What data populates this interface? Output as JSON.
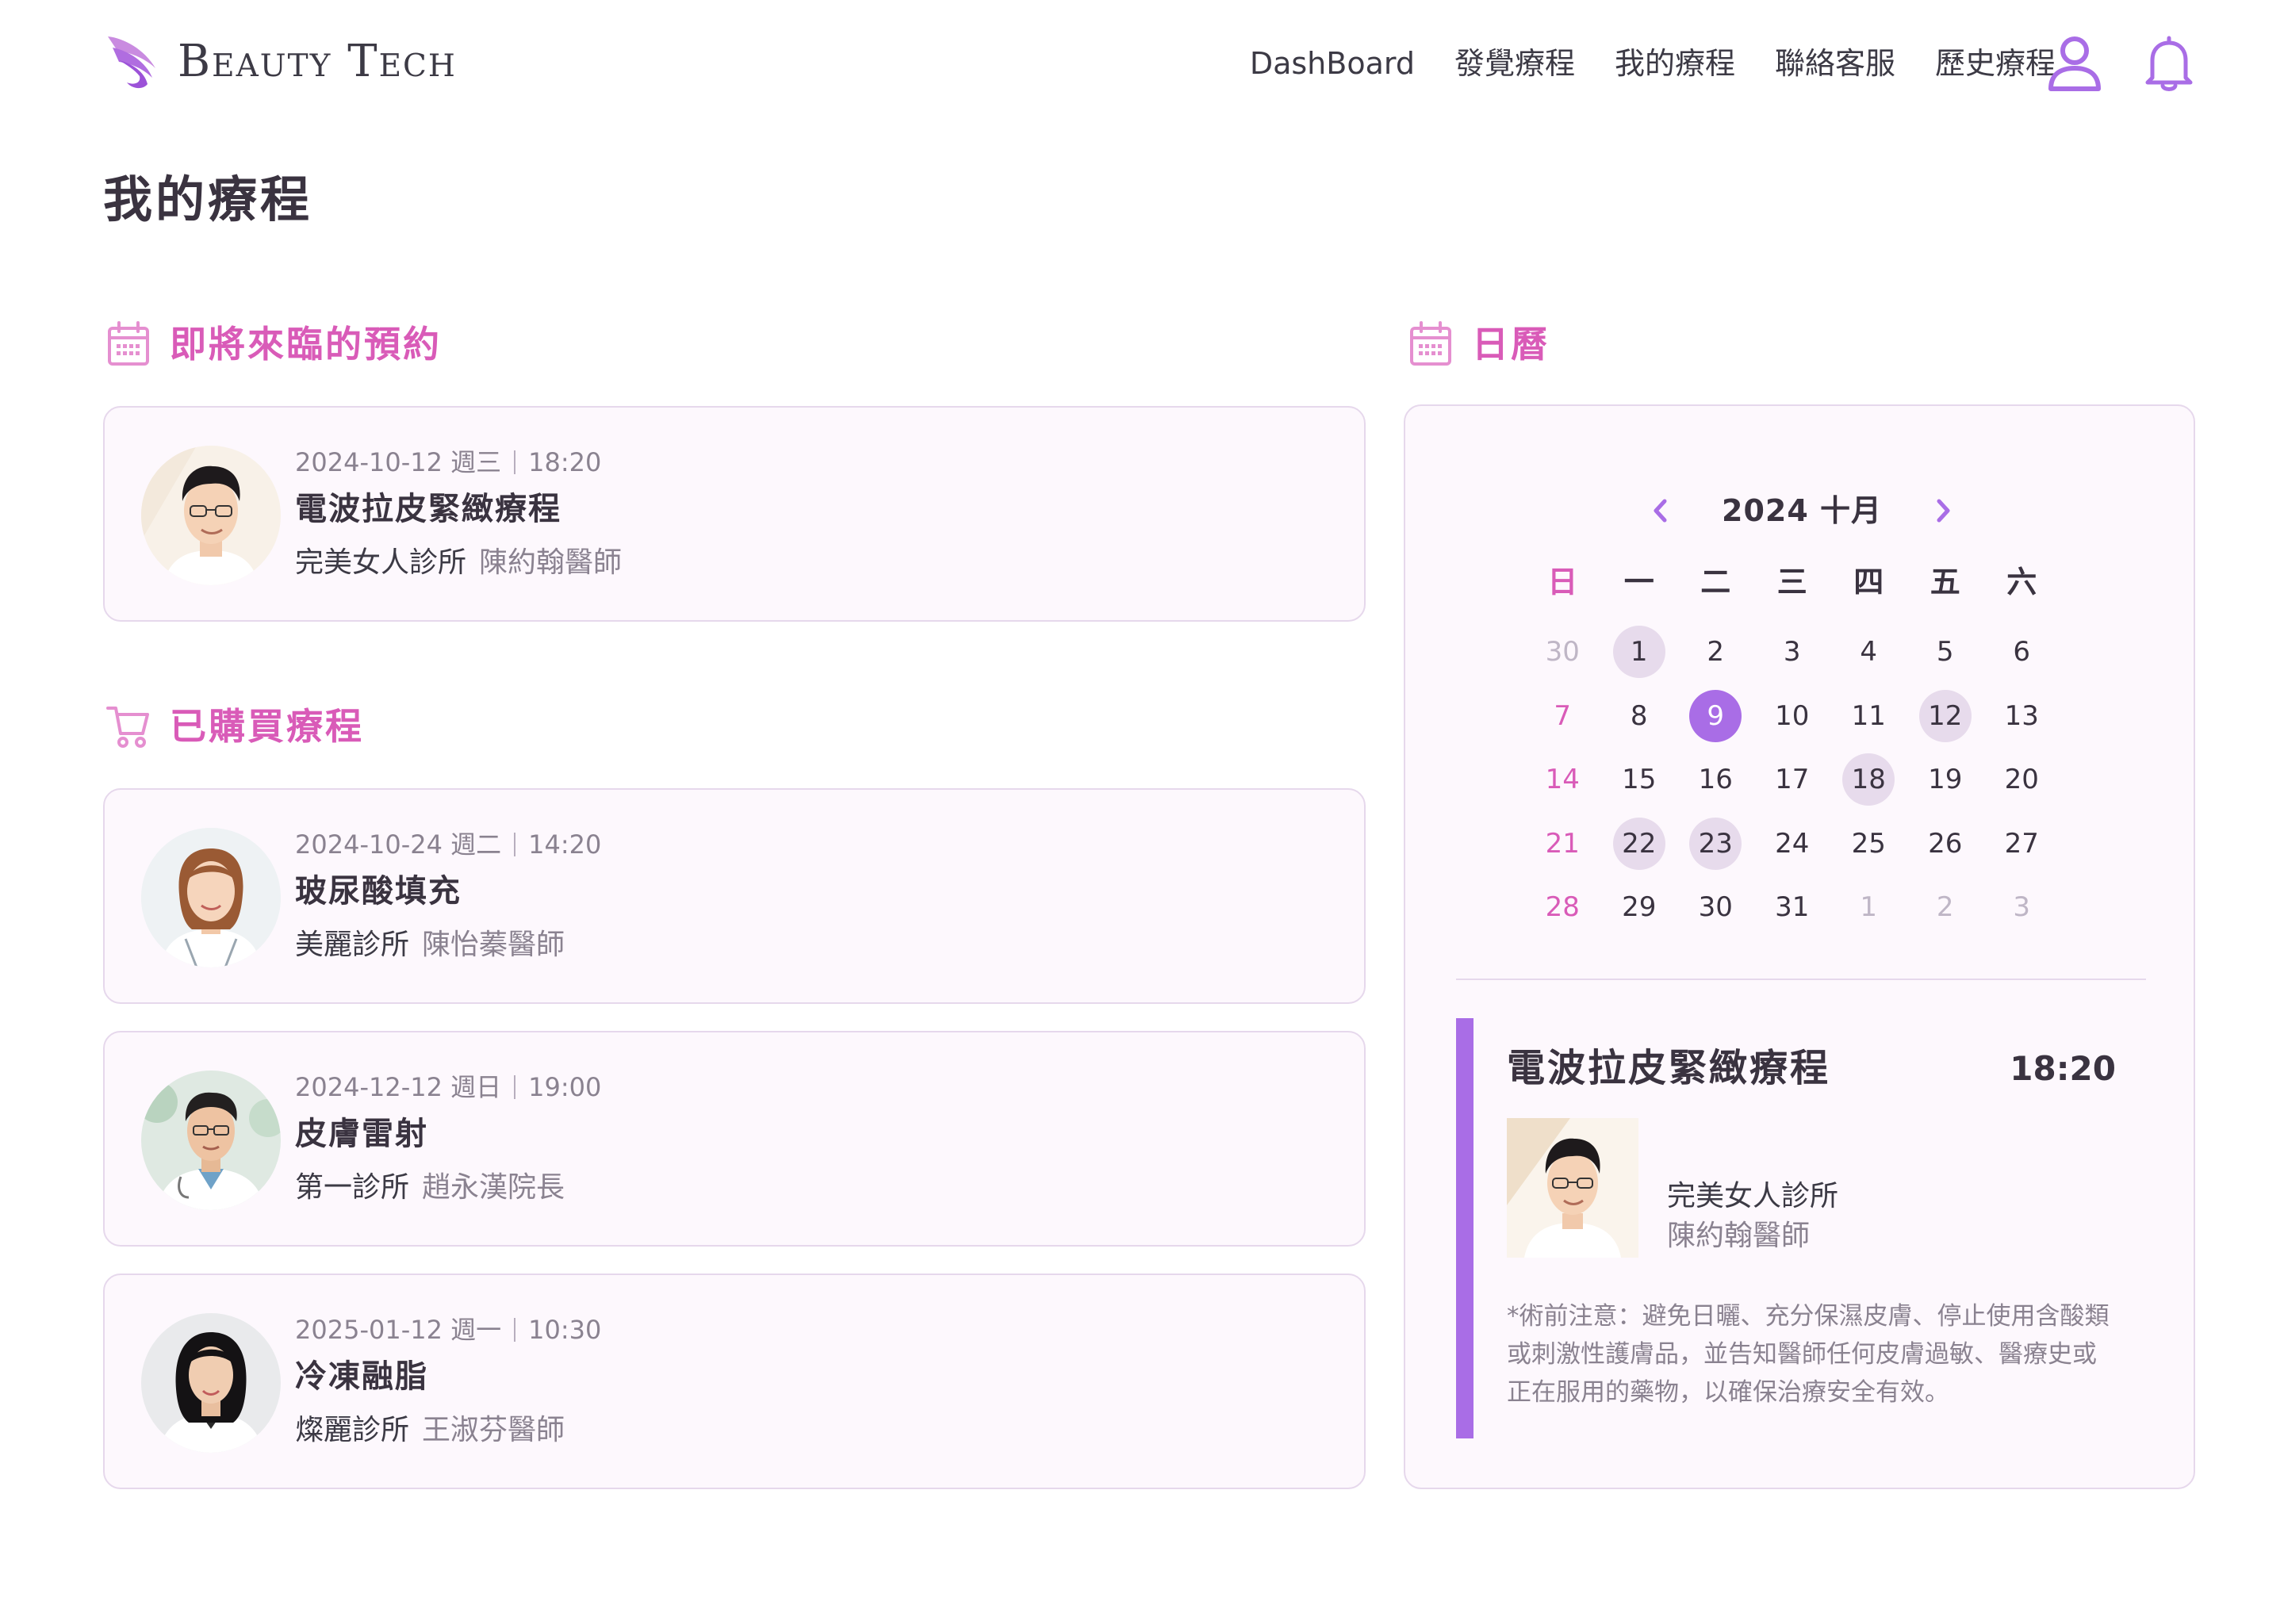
{
  "brand": {
    "name": "Beauty Tech",
    "accent": "#d95bb8",
    "primary": "#a96de6"
  },
  "nav": {
    "items": [
      "DashBoard",
      "發覺療程",
      "我的療程",
      "聯絡客服",
      "歷史療程"
    ]
  },
  "icons": {
    "user": "user-icon",
    "bell": "bell-icon",
    "calendar": "calendar-icon",
    "cart": "cart-icon"
  },
  "page": {
    "title": "我的療程"
  },
  "upcoming": {
    "heading": "即將來臨的預約",
    "items": [
      {
        "date": "2024-10-12 週三",
        "time": "18:20",
        "treatment": "電波拉皮緊緻療程",
        "clinic": "完美女人診所",
        "doctor": "陳約翰醫師"
      }
    ]
  },
  "purchased": {
    "heading": "已購買療程",
    "items": [
      {
        "date": "2024-10-24 週二",
        "time": "14:20",
        "treatment": "玻尿酸填充",
        "clinic": "美麗診所",
        "doctor": "陳怡蓁醫師"
      },
      {
        "date": "2024-12-12 週日",
        "time": "19:00",
        "treatment": "皮膚雷射",
        "clinic": "第一診所",
        "doctor": "趙永漢院長"
      },
      {
        "date": "2025-01-12 週一",
        "time": "10:30",
        "treatment": "冷凍融脂",
        "clinic": "燦麗診所",
        "doctor": "王淑芬醫師"
      }
    ]
  },
  "calendar": {
    "heading": "日曆",
    "month_label": "2024 十月",
    "weekdays": [
      "日",
      "一",
      "二",
      "三",
      "四",
      "五",
      "六"
    ],
    "days": [
      {
        "d": "30",
        "other": true
      },
      {
        "d": "1",
        "booked": true
      },
      {
        "d": "2"
      },
      {
        "d": "3"
      },
      {
        "d": "4"
      },
      {
        "d": "5"
      },
      {
        "d": "6"
      },
      {
        "d": "7"
      },
      {
        "d": "8"
      },
      {
        "d": "9",
        "selected": true
      },
      {
        "d": "10"
      },
      {
        "d": "11"
      },
      {
        "d": "12",
        "booked": true
      },
      {
        "d": "13"
      },
      {
        "d": "14"
      },
      {
        "d": "15"
      },
      {
        "d": "16"
      },
      {
        "d": "17"
      },
      {
        "d": "18",
        "booked": true
      },
      {
        "d": "19"
      },
      {
        "d": "20"
      },
      {
        "d": "21"
      },
      {
        "d": "22",
        "booked": true
      },
      {
        "d": "23",
        "booked": true
      },
      {
        "d": "24"
      },
      {
        "d": "25"
      },
      {
        "d": "26"
      },
      {
        "d": "27"
      },
      {
        "d": "28"
      },
      {
        "d": "29"
      },
      {
        "d": "30"
      },
      {
        "d": "31"
      },
      {
        "d": "1",
        "other": true
      },
      {
        "d": "2",
        "other": true
      },
      {
        "d": "3",
        "other": true
      }
    ],
    "detail": {
      "treatment": "電波拉皮緊緻療程",
      "time": "18:20",
      "clinic": "完美女人診所",
      "doctor": "陳約翰醫師",
      "note": "*術前注意：避免日曬、充分保濕皮膚、停止使用含酸類或刺激性護膚品，並告知醫師任何皮膚過敏、醫療史或正在服用的藥物，以確保治療安全有效。"
    }
  }
}
